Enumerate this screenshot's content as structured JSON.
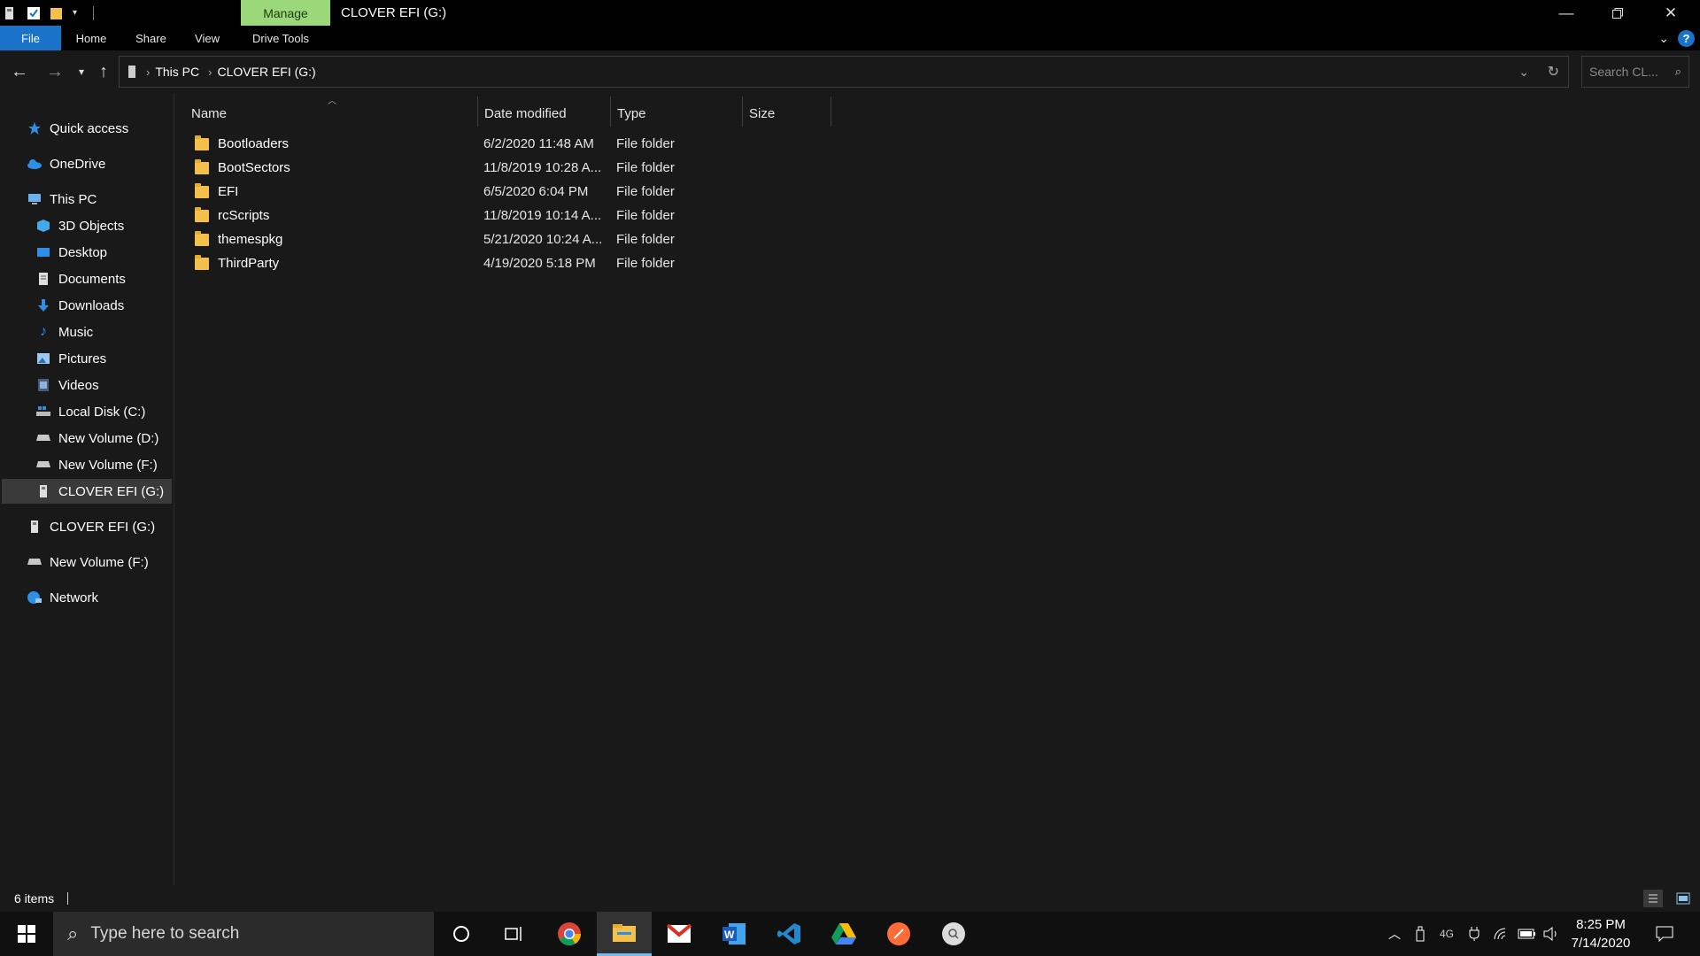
{
  "window": {
    "title": "CLOVER EFI (G:)",
    "manage_tab": "Manage"
  },
  "ribbon": {
    "tabs": [
      "File",
      "Home",
      "Share",
      "View",
      "Drive Tools"
    ]
  },
  "address": {
    "crumbs": [
      "This PC",
      "CLOVER EFI (G:)"
    ],
    "search_placeholder": "Search CL..."
  },
  "sidebar": {
    "items": [
      {
        "label": "Quick access",
        "icon": "star-icon"
      },
      {
        "label": "OneDrive",
        "icon": "cloud-icon"
      },
      {
        "label": "This PC",
        "icon": "computer-icon"
      },
      {
        "label": "3D Objects",
        "icon": "cube-icon"
      },
      {
        "label": "Desktop",
        "icon": "desktop-icon"
      },
      {
        "label": "Documents",
        "icon": "document-icon"
      },
      {
        "label": "Downloads",
        "icon": "download-icon"
      },
      {
        "label": "Music",
        "icon": "music-icon"
      },
      {
        "label": "Pictures",
        "icon": "picture-icon"
      },
      {
        "label": "Videos",
        "icon": "video-icon"
      },
      {
        "label": "Local Disk (C:)",
        "icon": "windows-drive-icon"
      },
      {
        "label": "New Volume (D:)",
        "icon": "drive-icon"
      },
      {
        "label": "New Volume (F:)",
        "icon": "drive-icon"
      },
      {
        "label": "CLOVER EFI (G:)",
        "icon": "usb-drive-icon"
      },
      {
        "label": "CLOVER EFI (G:)",
        "icon": "usb-drive-icon"
      },
      {
        "label": "New Volume (F:)",
        "icon": "drive-icon"
      },
      {
        "label": "Network",
        "icon": "network-icon"
      }
    ]
  },
  "columns": {
    "name": "Name",
    "date": "Date modified",
    "type": "Type",
    "size": "Size"
  },
  "files": [
    {
      "name": "Bootloaders",
      "date": "6/2/2020 11:48 AM",
      "type": "File folder",
      "size": ""
    },
    {
      "name": "BootSectors",
      "date": "11/8/2019 10:28 A...",
      "type": "File folder",
      "size": ""
    },
    {
      "name": "EFI",
      "date": "6/5/2020 6:04 PM",
      "type": "File folder",
      "size": ""
    },
    {
      "name": "rcScripts",
      "date": "11/8/2019 10:14 A...",
      "type": "File folder",
      "size": ""
    },
    {
      "name": "themespkg",
      "date": "5/21/2020 10:24 A...",
      "type": "File folder",
      "size": ""
    },
    {
      "name": "ThirdParty",
      "date": "4/19/2020 5:18 PM",
      "type": "File folder",
      "size": ""
    }
  ],
  "status": {
    "item_count": "6 items"
  },
  "taskbar": {
    "search_placeholder": "Type here to search",
    "network_label": "4G",
    "time": "8:25 PM",
    "date": "7/14/2020"
  },
  "colors": {
    "accent": "#1a73c9",
    "manage_tab": "#9ad879",
    "folder": "#f3c14b",
    "background": "#191919"
  }
}
